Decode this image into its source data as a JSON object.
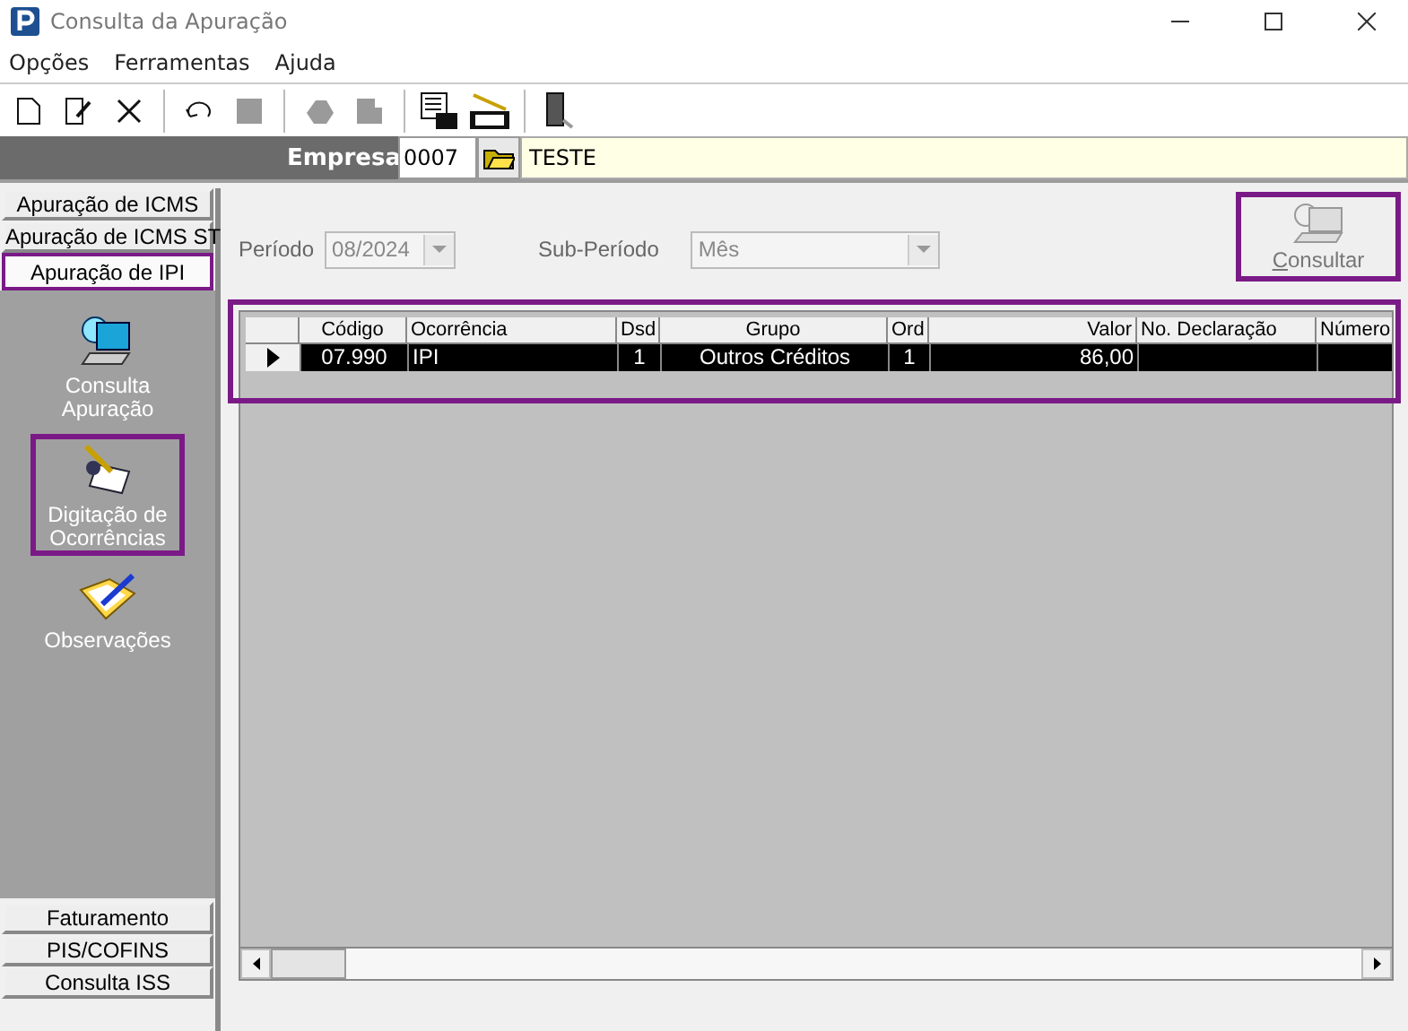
{
  "window": {
    "title": "Consulta da Apuração"
  },
  "menu": [
    "Opções",
    "Ferramentas",
    "Ajuda"
  ],
  "toolbar": [
    {
      "kind": "new",
      "disabled": false
    },
    {
      "kind": "edit",
      "disabled": false
    },
    {
      "kind": "delete",
      "disabled": false
    },
    {
      "kind": "sep"
    },
    {
      "kind": "undo",
      "disabled": false
    },
    {
      "kind": "stop",
      "disabled": true
    },
    {
      "kind": "sep"
    },
    {
      "kind": "blob",
      "disabled": true
    },
    {
      "kind": "blob2",
      "disabled": true
    },
    {
      "kind": "sep"
    },
    {
      "kind": "report",
      "disabled": false
    },
    {
      "kind": "dirf",
      "disabled": false
    },
    {
      "kind": "sep"
    },
    {
      "kind": "exit",
      "disabled": false
    }
  ],
  "empresa": {
    "label": "Empresa",
    "code": "0007",
    "name": "TESTE"
  },
  "sidebar": {
    "top_tabs": [
      {
        "label": "Apuração de ICMS",
        "selected": false,
        "highlighted": false
      },
      {
        "label": "Apuração de ICMS ST",
        "selected": false,
        "highlighted": false
      },
      {
        "label": "Apuração de IPI",
        "selected": true,
        "highlighted": true
      }
    ],
    "items": [
      {
        "label": "Consulta Apuração",
        "kind": "laptop",
        "highlighted": false
      },
      {
        "label": "Digitação de Ocorrências",
        "kind": "writing",
        "highlighted": true
      },
      {
        "label": "Observações",
        "kind": "notebook",
        "highlighted": false
      }
    ],
    "bottom_tabs": [
      {
        "label": "Faturamento",
        "selected": false
      },
      {
        "label": "PIS/COFINS",
        "selected": false
      },
      {
        "label": "Consulta ISS",
        "selected": false
      }
    ]
  },
  "filters": {
    "periodo_label": "Período",
    "periodo": "08/2024",
    "periodo_disabled": true,
    "subperiodo_label": "Sub-Período",
    "subperiodo": "Mês",
    "subperiodo_disabled": true
  },
  "consultar": {
    "label": "Consultar",
    "disabled": true,
    "highlighted": true
  },
  "table": {
    "highlighted": true,
    "columns": [
      "Código",
      "Ocorrência",
      "Dsd",
      "Grupo",
      "Ord",
      "Valor",
      "No. Declaração",
      "Número"
    ],
    "rows": [
      {
        "selected": true,
        "cells": [
          "07.990",
          "IPI",
          "1",
          "Outros Créditos",
          "1",
          "86,00",
          "",
          ""
        ]
      }
    ]
  }
}
